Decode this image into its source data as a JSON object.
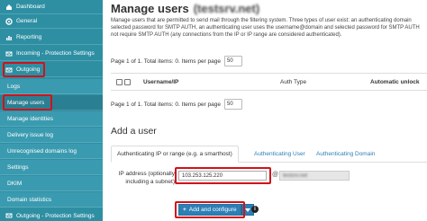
{
  "sidebar": {
    "top_items": [
      {
        "label": "Dashboard",
        "icon": "home-icon"
      },
      {
        "label": "General",
        "icon": "gear-icon"
      },
      {
        "label": "Reporting",
        "icon": "report-icon"
      },
      {
        "label": "Incoming - Protection Settings",
        "icon": "incoming-icon"
      },
      {
        "label": "Outgoing",
        "icon": "outgoing-icon"
      }
    ],
    "sub_items": [
      {
        "label": "Logs"
      },
      {
        "label": "Manage users"
      },
      {
        "label": "Manage identities"
      },
      {
        "label": "Delivery issue log"
      },
      {
        "label": "Unrecognised domains log"
      },
      {
        "label": "Settings"
      },
      {
        "label": "DKIM"
      },
      {
        "label": "Domain statistics"
      }
    ],
    "bottom_item": {
      "label": "Outgoing - Protection Settings",
      "icon": "outgoing-protection-icon"
    }
  },
  "main": {
    "title": "Manage users",
    "title_host": "(testsrv.net)",
    "description": "Manage users that are permitted to send mail through the filtering system. Three types of user exist: an authenticating domain selected password for SMTP AUTH, an authenticating user uses the username@domain and selected password for SMTP AUTH not require SMTP AUTH (any connections from the IP or IP range are considered authenticated).",
    "pager_text": "Page 1 of 1. Total items: 0. Items per page",
    "per_page": "50",
    "table": {
      "columns": [
        "Username/IP",
        "Auth Type",
        "Automatic unlock"
      ]
    },
    "pager_text_bottom": "Page 1 of 1. Total items: 0. Items per page",
    "per_page_bottom": "50",
    "add_title": "Add a user",
    "tabs": [
      "Authenticating IP or range (e.g. a smarthost)",
      "Authenticating User",
      "Authenticating Domain"
    ],
    "ip_label": "IP address (optionally including a subnet)",
    "ip_value": "103.253.125.220",
    "at_sign": "@",
    "user_value": "testsrv.net",
    "add_button": "Add and configure",
    "add_button_icon": "plus-icon",
    "dropdown_icon": "caret-down-icon",
    "info_icon": "info-icon"
  },
  "colors": {
    "sidebar_bg": "#2e8fa3",
    "accent": "#2d7fb6",
    "highlight": "#d0121b"
  }
}
